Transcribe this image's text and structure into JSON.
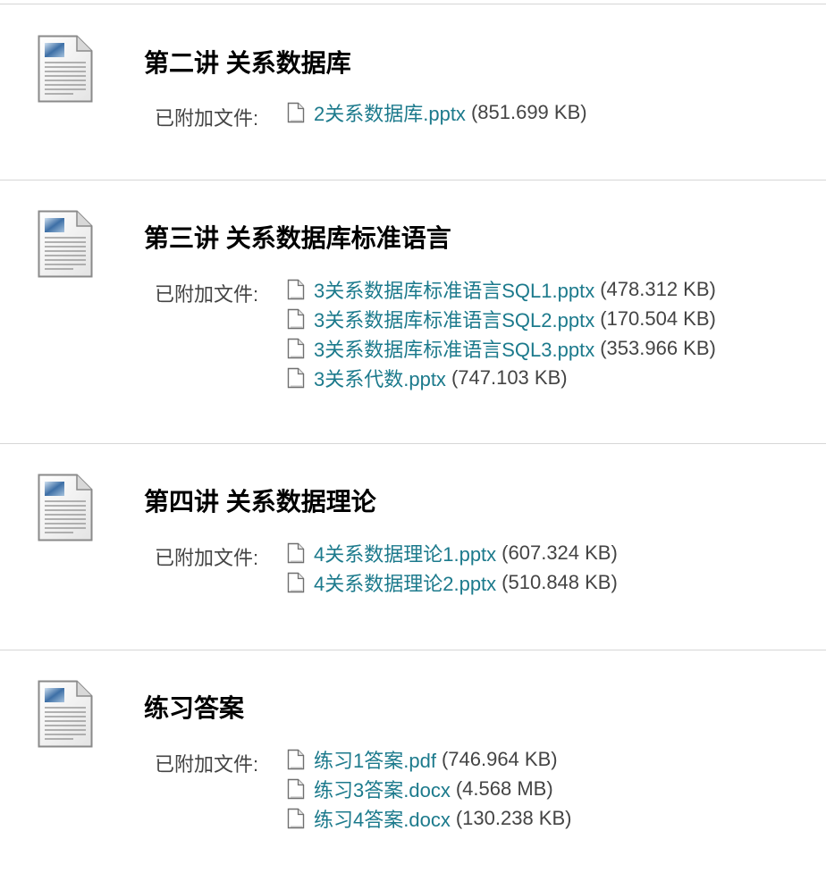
{
  "attach_label": "已附加文件:",
  "colors": {
    "link": "#1c7a8c",
    "title": "#000000",
    "text": "#444444",
    "divider": "#d6d6d6"
  },
  "icons": {
    "item": "document-icon",
    "file": "file-icon"
  },
  "items": [
    {
      "title": "第二讲 关系数据库",
      "files": [
        {
          "name": "2关系数据库.pptx",
          "size": "(851.699 KB)"
        }
      ]
    },
    {
      "title": "第三讲 关系数据库标准语言",
      "files": [
        {
          "name": "3关系数据库标准语言SQL1.pptx",
          "size": "(478.312 KB)"
        },
        {
          "name": "3关系数据库标准语言SQL2.pptx",
          "size": "(170.504 KB)"
        },
        {
          "name": "3关系数据库标准语言SQL3.pptx",
          "size": "(353.966 KB)"
        },
        {
          "name": "3关系代数.pptx",
          "size": "(747.103 KB)"
        }
      ]
    },
    {
      "title": "第四讲 关系数据理论",
      "files": [
        {
          "name": "4关系数据理论1.pptx",
          "size": "(607.324 KB)"
        },
        {
          "name": "4关系数据理论2.pptx",
          "size": "(510.848 KB)"
        }
      ]
    },
    {
      "title": "练习答案",
      "files": [
        {
          "name": "练习1答案.pdf",
          "size": "(746.964 KB)"
        },
        {
          "name": "练习3答案.docx",
          "size": "(4.568 MB)"
        },
        {
          "name": "练习4答案.docx",
          "size": "(130.238 KB)"
        }
      ]
    }
  ]
}
